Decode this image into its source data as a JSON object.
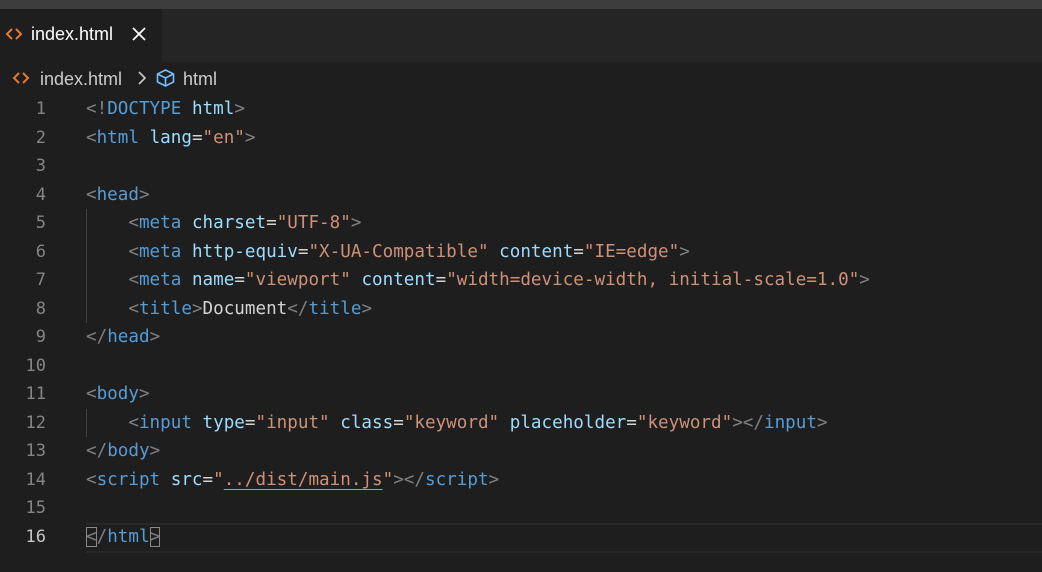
{
  "tab": {
    "label": "index.html"
  },
  "breadcrumb": {
    "file": "index.html",
    "symbol": "html"
  },
  "editor": {
    "active_line": 16,
    "lines": [
      {
        "num": "1",
        "tokens": [
          [
            "bracket",
            "<!"
          ],
          [
            "tag",
            "DOCTYPE"
          ],
          [
            "text",
            " "
          ],
          [
            "attr",
            "html"
          ],
          [
            "bracket",
            ">"
          ]
        ]
      },
      {
        "num": "2",
        "tokens": [
          [
            "bracket",
            "<"
          ],
          [
            "tag",
            "html"
          ],
          [
            "text",
            " "
          ],
          [
            "attr",
            "lang"
          ],
          [
            "eq",
            "="
          ],
          [
            "str",
            "\"en\""
          ],
          [
            "bracket",
            ">"
          ]
        ]
      },
      {
        "num": "3",
        "tokens": []
      },
      {
        "num": "4",
        "tokens": [
          [
            "bracket",
            "<"
          ],
          [
            "tag",
            "head"
          ],
          [
            "bracket",
            ">"
          ]
        ]
      },
      {
        "num": "5",
        "tokens": [
          [
            "text",
            "    "
          ],
          [
            "bracket",
            "<"
          ],
          [
            "tag",
            "meta"
          ],
          [
            "text",
            " "
          ],
          [
            "attr",
            "charset"
          ],
          [
            "eq",
            "="
          ],
          [
            "str",
            "\"UTF-8\""
          ],
          [
            "bracket",
            ">"
          ]
        ]
      },
      {
        "num": "6",
        "tokens": [
          [
            "text",
            "    "
          ],
          [
            "bracket",
            "<"
          ],
          [
            "tag",
            "meta"
          ],
          [
            "text",
            " "
          ],
          [
            "attr",
            "http-equiv"
          ],
          [
            "eq",
            "="
          ],
          [
            "str",
            "\"X-UA-Compatible\""
          ],
          [
            "text",
            " "
          ],
          [
            "attr",
            "content"
          ],
          [
            "eq",
            "="
          ],
          [
            "str",
            "\"IE=edge\""
          ],
          [
            "bracket",
            ">"
          ]
        ]
      },
      {
        "num": "7",
        "tokens": [
          [
            "text",
            "    "
          ],
          [
            "bracket",
            "<"
          ],
          [
            "tag",
            "meta"
          ],
          [
            "text",
            " "
          ],
          [
            "attr",
            "name"
          ],
          [
            "eq",
            "="
          ],
          [
            "str",
            "\"viewport\""
          ],
          [
            "text",
            " "
          ],
          [
            "attr",
            "content"
          ],
          [
            "eq",
            "="
          ],
          [
            "str",
            "\"width=device-width, initial-scale=1.0\""
          ],
          [
            "bracket",
            ">"
          ]
        ]
      },
      {
        "num": "8",
        "tokens": [
          [
            "text",
            "    "
          ],
          [
            "bracket",
            "<"
          ],
          [
            "tag",
            "title"
          ],
          [
            "bracket",
            ">"
          ],
          [
            "text",
            "Document"
          ],
          [
            "bracket",
            "</"
          ],
          [
            "tag",
            "title"
          ],
          [
            "bracket",
            ">"
          ]
        ]
      },
      {
        "num": "9",
        "tokens": [
          [
            "bracket",
            "</"
          ],
          [
            "tag",
            "head"
          ],
          [
            "bracket",
            ">"
          ]
        ]
      },
      {
        "num": "10",
        "tokens": []
      },
      {
        "num": "11",
        "tokens": [
          [
            "bracket",
            "<"
          ],
          [
            "tag",
            "body"
          ],
          [
            "bracket",
            ">"
          ]
        ]
      },
      {
        "num": "12",
        "tokens": [
          [
            "text",
            "    "
          ],
          [
            "bracket",
            "<"
          ],
          [
            "tag",
            "input"
          ],
          [
            "text",
            " "
          ],
          [
            "attr",
            "type"
          ],
          [
            "eq",
            "="
          ],
          [
            "str",
            "\"input\""
          ],
          [
            "text",
            " "
          ],
          [
            "attr",
            "class"
          ],
          [
            "eq",
            "="
          ],
          [
            "str",
            "\"keyword\""
          ],
          [
            "text",
            " "
          ],
          [
            "attr",
            "placeholder"
          ],
          [
            "eq",
            "="
          ],
          [
            "str",
            "\"keyword\""
          ],
          [
            "bracket",
            "></"
          ],
          [
            "tag",
            "input"
          ],
          [
            "bracket",
            ">"
          ]
        ]
      },
      {
        "num": "13",
        "tokens": [
          [
            "bracket",
            "</"
          ],
          [
            "tag",
            "body"
          ],
          [
            "bracket",
            ">"
          ]
        ]
      },
      {
        "num": "14",
        "tokens": [
          [
            "bracket",
            "<"
          ],
          [
            "tag",
            "script"
          ],
          [
            "text",
            " "
          ],
          [
            "attr",
            "src"
          ],
          [
            "eq",
            "="
          ],
          [
            "str",
            "\""
          ],
          [
            "strlink",
            "../dist/main.js"
          ],
          [
            "str",
            "\""
          ],
          [
            "bracket",
            "></"
          ],
          [
            "tag",
            "script"
          ],
          [
            "bracket",
            ">"
          ]
        ]
      },
      {
        "num": "15",
        "tokens": []
      },
      {
        "num": "16",
        "tokens": [
          [
            "bm",
            "<"
          ],
          [
            "bracket",
            "/"
          ],
          [
            "tag",
            "html"
          ],
          [
            "bm",
            ">"
          ]
        ]
      }
    ]
  },
  "colors": {
    "tag": "#569cd6",
    "attr": "#9cdcfe",
    "string": "#ce9178",
    "bracket": "#808080",
    "file_icon": "#e37933",
    "symbol_icon": "#75beff"
  }
}
